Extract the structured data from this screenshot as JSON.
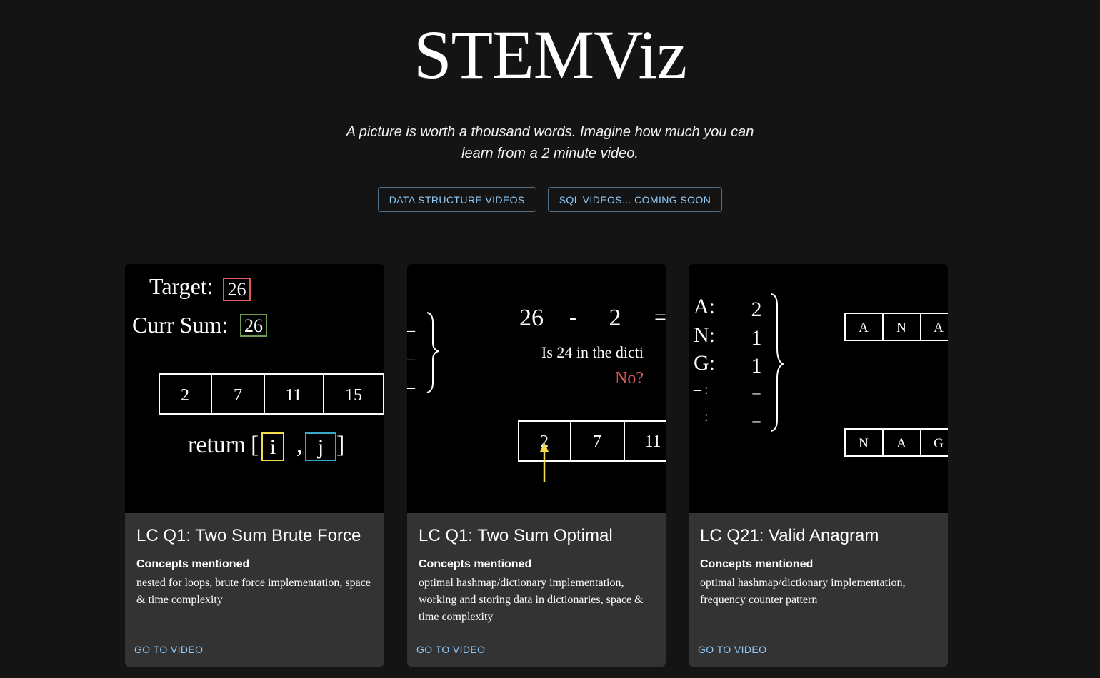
{
  "site": {
    "title": "STEMViz",
    "tagline": "A picture is worth a thousand words. Imagine how much you can learn from a 2 minute video."
  },
  "nav": {
    "buttons": [
      {
        "label": "DATA STRUCTURE VIDEOS"
      },
      {
        "label": "SQL VIDEOS... COMING SOON"
      }
    ]
  },
  "cards": [
    {
      "title": "LC Q1: Two Sum Brute Force",
      "concepts_label": "Concepts mentioned",
      "concepts": "nested for loops, brute force implementation, space & time complexity",
      "link": "GO TO VIDEO",
      "thumb": {
        "target_label": "Target:",
        "target_value": "26",
        "sum_label": "Curr Sum:",
        "sum_value": "26",
        "array": [
          "2",
          "7",
          "11",
          "15"
        ],
        "return_word": "return",
        "open_bracket": "[",
        "comma": ",",
        "close_bracket": "]",
        "i": "i",
        "j": "j"
      }
    },
    {
      "title": "LC Q1: Two Sum Optimal",
      "concepts_label": "Concepts mentioned",
      "concepts": "optimal hashmap/dictionary implementation, working and storing data in dictionaries, space & time complexity",
      "link": "GO TO VIDEO",
      "thumb": {
        "dashes": [
          "_",
          "_",
          "_"
        ],
        "eq_a": "26",
        "eq_op": "-",
        "eq_b": "2",
        "eq_eq": "=",
        "question": "Is 24 in the dicti",
        "answer": "No?",
        "array": [
          "2",
          "7",
          "11"
        ]
      }
    },
    {
      "title": "LC Q21: Valid Anagram",
      "concepts_label": "Concepts mentioned",
      "concepts": "optimal hashmap/dictionary implementation, frequency counter pattern",
      "link": "GO TO VIDEO",
      "thumb": {
        "keys": [
          "A:",
          "N:",
          "G:",
          "– :",
          "– :"
        ],
        "vals": [
          "2",
          "1",
          "1",
          "–",
          "–"
        ],
        "top_row": [
          "A",
          "N",
          "A"
        ],
        "bottom_row": [
          "N",
          "A",
          "G"
        ]
      }
    }
  ],
  "colors": {
    "background": "#141414",
    "card": "#333333",
    "accent": "#90caf9",
    "red": "#e05a5a",
    "green": "#6f9a5a",
    "yellow": "#f5dc4a",
    "blue": "#3aa7c9"
  }
}
